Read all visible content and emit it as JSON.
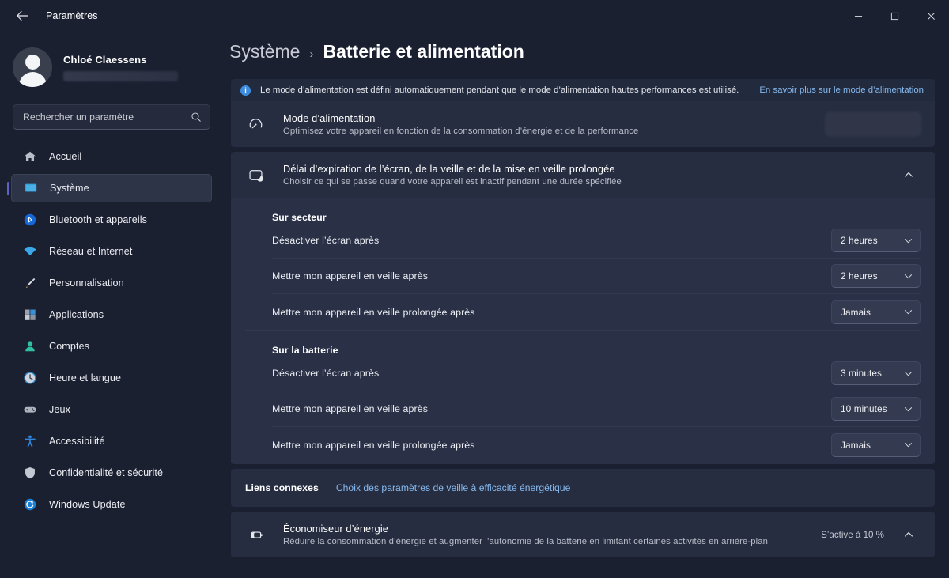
{
  "window": {
    "title": "Paramètres",
    "back_icon": "arrow-left-icon",
    "minimize_label": "—",
    "maximize_label": "◻",
    "close_label": "✕"
  },
  "sidebar": {
    "profile": {
      "name": "Chloé Claessens",
      "avatar_icon": "avatar-icon"
    },
    "search": {
      "placeholder": "Rechercher un paramètre",
      "value": "",
      "icon": "search-icon"
    },
    "items": [
      {
        "label": "Accueil",
        "icon": "home-icon",
        "selected": false
      },
      {
        "label": "Système",
        "icon": "monitor-icon",
        "selected": true
      },
      {
        "label": "Bluetooth et appareils",
        "icon": "bluetooth-icon",
        "selected": false
      },
      {
        "label": "Réseau et Internet",
        "icon": "wifi-icon",
        "selected": false
      },
      {
        "label": "Personnalisation",
        "icon": "brush-icon",
        "selected": false
      },
      {
        "label": "Applications",
        "icon": "apps-icon",
        "selected": false
      },
      {
        "label": "Comptes",
        "icon": "person-icon",
        "selected": false
      },
      {
        "label": "Heure et langue",
        "icon": "clock-icon",
        "selected": false
      },
      {
        "label": "Jeux",
        "icon": "gamepad-icon",
        "selected": false
      },
      {
        "label": "Accessibilité",
        "icon": "accessibility-icon",
        "selected": false
      },
      {
        "label": "Confidentialité et sécurité",
        "icon": "shield-icon",
        "selected": false
      },
      {
        "label": "Windows Update",
        "icon": "update-icon",
        "selected": false
      }
    ]
  },
  "breadcrumb": {
    "parent": "Système",
    "separator": "›",
    "current": "Batterie et alimentation"
  },
  "banner": {
    "icon": "info-icon",
    "glyph": "i",
    "text": "Le mode d’alimentation est défini automatiquement pendant que le mode d’alimentation hautes performances est utilisé.",
    "link": "En savoir plus sur le mode d’alimentation"
  },
  "power_mode_card": {
    "icon": "gauge-icon",
    "title": "Mode d’alimentation",
    "subtitle": "Optimisez votre appareil en fonction de la consommation d’énergie et de la performance",
    "combo_value": "",
    "combo_state": "disabled"
  },
  "timeout_card": {
    "icon": "screen-sleep-icon",
    "title": "Délai d’expiration de l’écran, de la veille et de la mise en veille prolongée",
    "subtitle": "Choisir ce qui se passe quand votre appareil est inactif pendant une durée spécifiée",
    "expanded": true,
    "chevron_icon": "chevron-up-icon",
    "groups": [
      {
        "title": "Sur secteur",
        "rows": [
          {
            "label": "Désactiver l’écran après",
            "value": "2 heures",
            "chevron": "chevron-down-icon"
          },
          {
            "label": "Mettre mon appareil en veille après",
            "value": "2 heures",
            "chevron": "chevron-down-icon"
          },
          {
            "label": "Mettre mon appareil en veille prolongée après",
            "value": "Jamais",
            "chevron": "chevron-down-icon"
          }
        ]
      },
      {
        "title": "Sur la batterie",
        "rows": [
          {
            "label": "Désactiver l’écran après",
            "value": "3 minutes",
            "chevron": "chevron-down-icon"
          },
          {
            "label": "Mettre mon appareil en veille après",
            "value": "10 minutes",
            "chevron": "chevron-down-icon"
          },
          {
            "label": "Mettre mon appareil en veille prolongée après",
            "value": "Jamais",
            "chevron": "chevron-down-icon"
          }
        ]
      }
    ]
  },
  "related": {
    "title": "Liens connexes",
    "link": "Choix des paramètres de veille à efficacité énergétique"
  },
  "energy_saver_card": {
    "icon": "battery-saver-icon",
    "title": "Économiseur d’énergie",
    "subtitle": "Réduire la consommation d’énergie et augmenter l’autonomie de la batterie en limitant certaines activités en arrière-plan",
    "status": "S’active à 10 %",
    "chevron_icon": "chevron-up-icon"
  },
  "colors": {
    "app_background": "#1b2031",
    "card_background": "#262d40",
    "expanded_background": "#2a3147",
    "accent": "#5b62c6",
    "link": "#86b9ef",
    "info_blue": "#3d8ce0"
  }
}
